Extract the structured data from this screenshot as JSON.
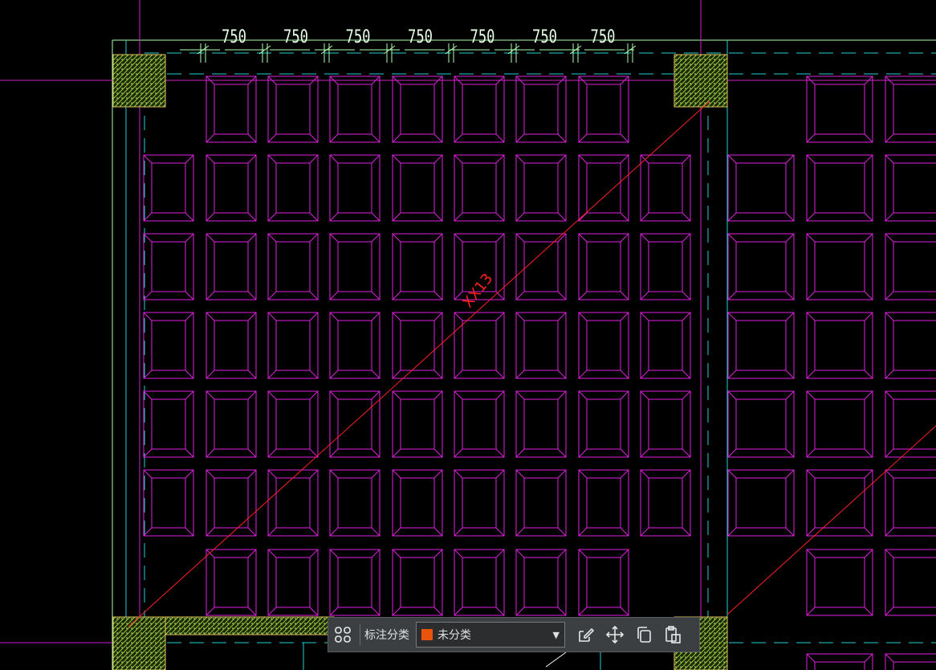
{
  "drawing": {
    "dimension_labels": [
      "750",
      "750",
      "750",
      "750",
      "750",
      "750",
      "750"
    ],
    "diagonal_label": "XX13",
    "colors": {
      "background": "#000000",
      "grid_lines": "#cc22cc",
      "waffle_cells": "#e020e0",
      "axis_lines": "#20d0d0",
      "dimensions": "#b0ffb0",
      "diagonal": "#ff2020",
      "columns_hatch": "#9acd32"
    }
  },
  "toolbar": {
    "label": "标注分类",
    "category_value": "未分类",
    "category_color": "#e8550a",
    "icons": [
      "quick-select-icon",
      "edit-icon",
      "move-icon",
      "copy-icon",
      "paste-icon"
    ]
  }
}
